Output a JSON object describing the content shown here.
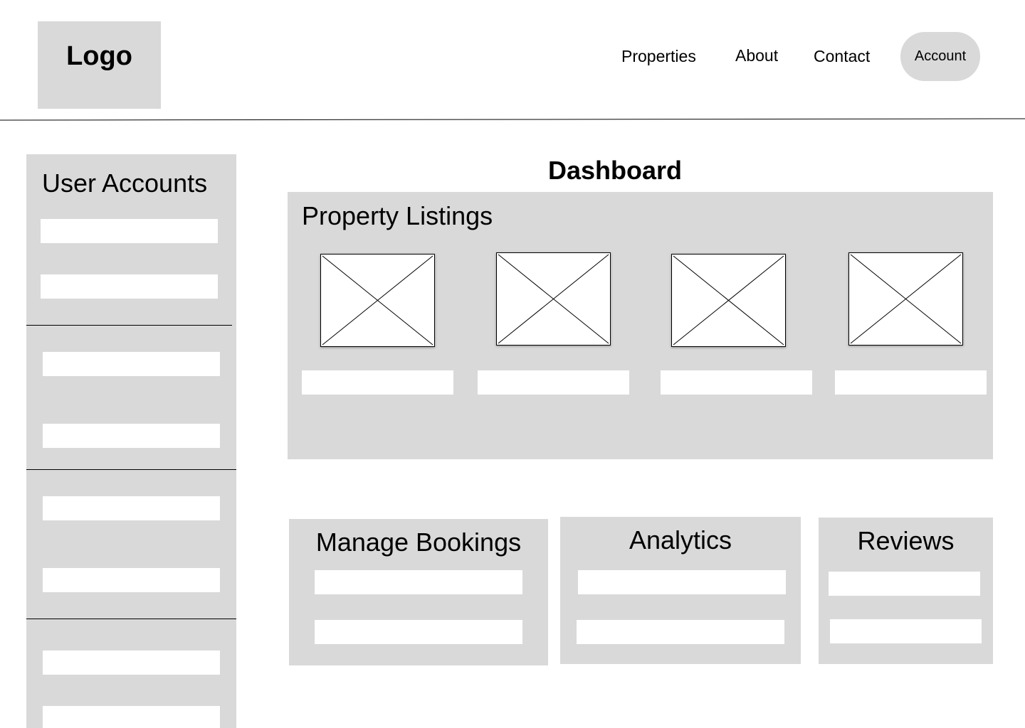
{
  "header": {
    "logo": "Logo",
    "nav": {
      "properties": "Properties",
      "about": "About",
      "contact": "Contact",
      "account": "Account"
    }
  },
  "sidebar": {
    "title": "User Accounts"
  },
  "main": {
    "title": "Dashboard",
    "listings": {
      "title": "Property Listings"
    },
    "cards": {
      "bookings": "Manage Bookings",
      "analytics": "Analytics",
      "reviews": "Reviews"
    }
  },
  "colors": {
    "panel": "#d9d9d9",
    "field": "#ffffff",
    "text": "#000000"
  },
  "icons": {
    "image_placeholder": "image-placeholder-icon"
  }
}
